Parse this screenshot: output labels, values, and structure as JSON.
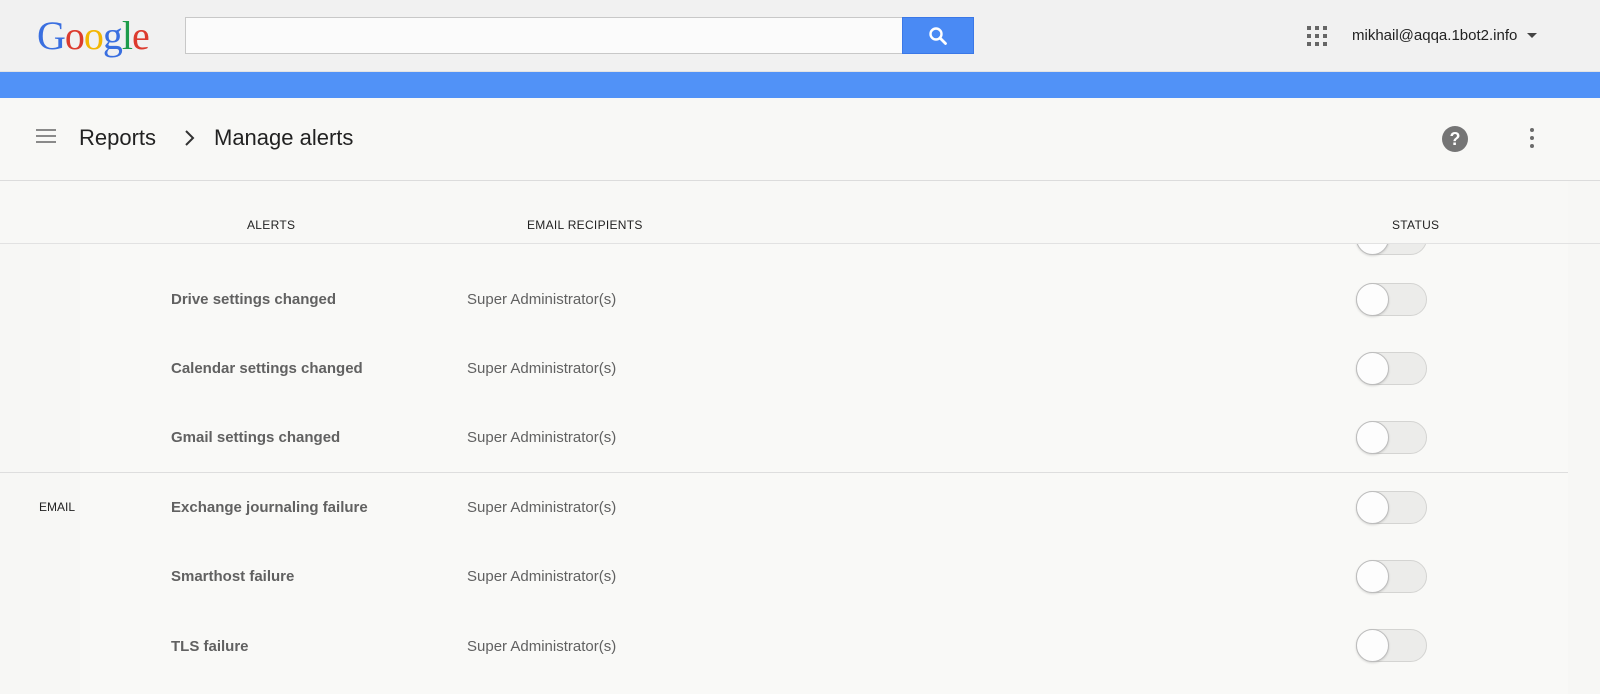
{
  "logo": {
    "letters": [
      {
        "char": "G",
        "color": "#3a6fe0"
      },
      {
        "char": "o",
        "color": "#dc3b2e"
      },
      {
        "char": "o",
        "color": "#f3b602"
      },
      {
        "char": "g",
        "color": "#3a6fe0"
      },
      {
        "char": "l",
        "color": "#1d9c4a"
      },
      {
        "char": "e",
        "color": "#dc3b2e"
      }
    ]
  },
  "search": {
    "value": "",
    "placeholder": "",
    "icon": "search-icon"
  },
  "header": {
    "account": "mikhail@aqqa.1bot2.info",
    "apps_icon": "apps-grid-icon"
  },
  "accent": {
    "blue_band": "#5192f7",
    "search_button": "#4a8af4"
  },
  "breadcrumb": {
    "parent": "Reports",
    "current": "Manage alerts"
  },
  "actions": {
    "help": "?",
    "help_icon": "help-icon",
    "more_icon": "more-vert-icon"
  },
  "columns": {
    "alerts": "ALERTS",
    "recipients": "EMAIL RECIPIENTS",
    "status": "STATUS"
  },
  "groups": [
    {
      "label": "",
      "rows": [
        {
          "alert": "Drive settings changed",
          "recipients": "Super Administrator(s)",
          "enabled": false
        },
        {
          "alert": "Calendar settings changed",
          "recipients": "Super Administrator(s)",
          "enabled": false
        },
        {
          "alert": "Gmail settings changed",
          "recipients": "Super Administrator(s)",
          "enabled": false
        }
      ]
    },
    {
      "label": "EMAIL",
      "rows": [
        {
          "alert": "Exchange journaling failure",
          "recipients": "Super Administrator(s)",
          "enabled": false
        },
        {
          "alert": "Smarthost failure",
          "recipients": "Super Administrator(s)",
          "enabled": false
        },
        {
          "alert": "TLS failure",
          "recipients": "Super Administrator(s)",
          "enabled": false
        }
      ]
    }
  ]
}
